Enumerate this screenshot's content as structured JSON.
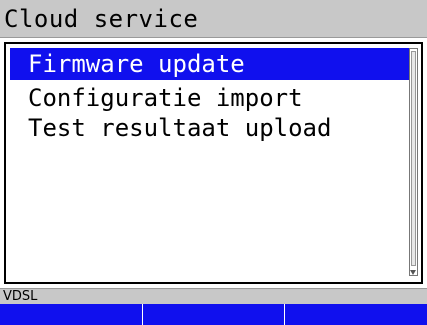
{
  "title": "Cloud service",
  "menu": {
    "items": [
      {
        "label": "Firmware update",
        "selected": true
      },
      {
        "label": "Configuratie import",
        "selected": false
      },
      {
        "label": "Test resultaat upload",
        "selected": false
      }
    ]
  },
  "status": {
    "text": "VDSL"
  },
  "softkeys": [
    {
      "label": ""
    },
    {
      "label": ""
    },
    {
      "label": ""
    }
  ],
  "colors": {
    "selection": "#1010ee",
    "bar_gray": "#c8c8c8",
    "softkey_blue": "#1010ee"
  }
}
